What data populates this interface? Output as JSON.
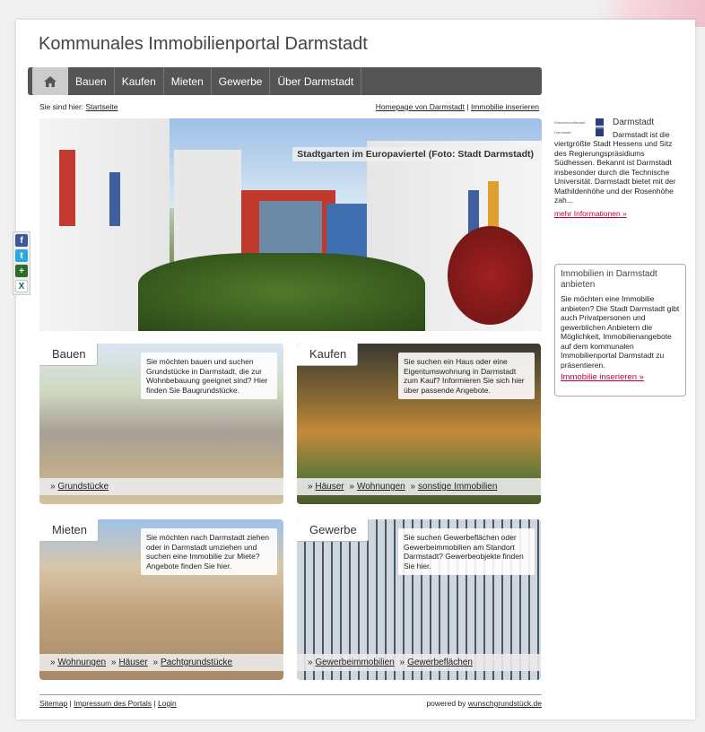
{
  "site": {
    "title": "Kommunales Immobilienportal Darmstadt"
  },
  "nav": {
    "items": [
      {
        "label": "Bauen"
      },
      {
        "label": "Kaufen"
      },
      {
        "label": "Mieten"
      },
      {
        "label": "Gewerbe"
      },
      {
        "label": "Über Darmstadt"
      }
    ]
  },
  "breadcrumb": {
    "prefix": "Sie sind hier:",
    "current": "Startseite"
  },
  "toplinks": {
    "homepage": "Homepage von Darmstadt",
    "sep": "|",
    "insert": "Immobilie inserieren"
  },
  "hero": {
    "caption": "Stadtgarten im Europaviertel (Foto: Stadt Darmstadt)"
  },
  "share": {
    "facebook": "f",
    "twitter": "t",
    "plus": "+",
    "xing": "X"
  },
  "cards": [
    {
      "label": "Bauen",
      "desc": "Sie möchten bauen und suchen Grundstücke in Darmstadt, die zur Wohnbebauung geeignet sind? Hier finden Sie Baugrundstücke.",
      "links": [
        "Grundstücke"
      ]
    },
    {
      "label": "Kaufen",
      "desc": "Sie suchen ein Haus oder eine Eigentumswohnung in Darmstadt zum Kauf? Informieren Sie sich hier über passende Angebote.",
      "links": [
        "Häuser",
        "Wohnungen",
        "sonstige Immobilien"
      ]
    },
    {
      "label": "Mieten",
      "desc": "Sie möchten nach Darmstadt ziehen oder in Darmstadt umziehen und suchen eine Immobilie zur Miete? Angebote finden Sie hier.",
      "links": [
        "Wohnungen",
        "Häuser",
        "Pachtgrundstücke"
      ]
    },
    {
      "label": "Gewerbe",
      "desc": "Sie suchen Gewerbeflächen oder Gewerbeimmobilien am Standort Darmstadt? Gewerbeobjekte finden Sie hier.",
      "links": [
        "Gewerbeimmobilien",
        "Gewerbeflächen"
      ]
    }
  ],
  "side_info": {
    "logo_text": "Wissenschaftsstadt Darmstadt",
    "title": "Darmstadt",
    "text": "Darmstadt ist die viertgrößte Stadt Hessens und Sitz des Regierungspräsidiums Südhessen. Bekannt ist Darmstadt insbesonder durch die Technische Universität. Darmstadt bietet mit der Mathildenhöhe und der Rosenhöhe zah...",
    "more": "mehr Informationen »"
  },
  "side_offer": {
    "title": "Immobilien in Darmstadt anbieten",
    "text": "Sie möchten eine Immobilie anbieten? Die Stadt Darmstadt gibt auch Privatpersonen und gewerblichen Anbietern die Möglichkeit, Immobilienangebote auf dem kommunalen Immobilienportal Darmstadt zu präsentieren.",
    "more": "Immobilie inserieren »"
  },
  "footer": {
    "sitemap": "Sitemap",
    "impressum": "Impressum des Portals",
    "login": "Login",
    "powered": "powered by",
    "powered_link": "wunschgrundstück.de"
  },
  "colors": {
    "nav_bg": "#555555",
    "accent_link": "#c0003c"
  }
}
